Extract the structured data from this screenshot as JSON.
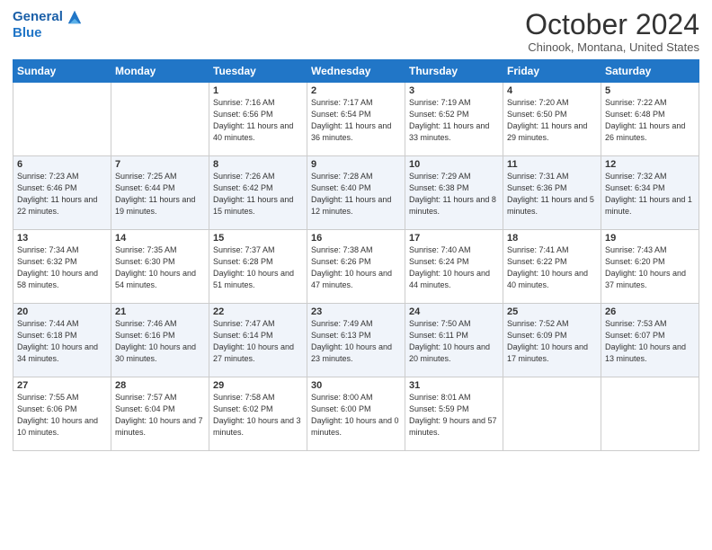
{
  "header": {
    "logo_line1": "General",
    "logo_line2": "Blue",
    "month": "October 2024",
    "location": "Chinook, Montana, United States"
  },
  "days_of_week": [
    "Sunday",
    "Monday",
    "Tuesday",
    "Wednesday",
    "Thursday",
    "Friday",
    "Saturday"
  ],
  "weeks": [
    [
      {
        "day": "",
        "info": ""
      },
      {
        "day": "",
        "info": ""
      },
      {
        "day": "1",
        "info": "Sunrise: 7:16 AM\nSunset: 6:56 PM\nDaylight: 11 hours and 40 minutes."
      },
      {
        "day": "2",
        "info": "Sunrise: 7:17 AM\nSunset: 6:54 PM\nDaylight: 11 hours and 36 minutes."
      },
      {
        "day": "3",
        "info": "Sunrise: 7:19 AM\nSunset: 6:52 PM\nDaylight: 11 hours and 33 minutes."
      },
      {
        "day": "4",
        "info": "Sunrise: 7:20 AM\nSunset: 6:50 PM\nDaylight: 11 hours and 29 minutes."
      },
      {
        "day": "5",
        "info": "Sunrise: 7:22 AM\nSunset: 6:48 PM\nDaylight: 11 hours and 26 minutes."
      }
    ],
    [
      {
        "day": "6",
        "info": "Sunrise: 7:23 AM\nSunset: 6:46 PM\nDaylight: 11 hours and 22 minutes."
      },
      {
        "day": "7",
        "info": "Sunrise: 7:25 AM\nSunset: 6:44 PM\nDaylight: 11 hours and 19 minutes."
      },
      {
        "day": "8",
        "info": "Sunrise: 7:26 AM\nSunset: 6:42 PM\nDaylight: 11 hours and 15 minutes."
      },
      {
        "day": "9",
        "info": "Sunrise: 7:28 AM\nSunset: 6:40 PM\nDaylight: 11 hours and 12 minutes."
      },
      {
        "day": "10",
        "info": "Sunrise: 7:29 AM\nSunset: 6:38 PM\nDaylight: 11 hours and 8 minutes."
      },
      {
        "day": "11",
        "info": "Sunrise: 7:31 AM\nSunset: 6:36 PM\nDaylight: 11 hours and 5 minutes."
      },
      {
        "day": "12",
        "info": "Sunrise: 7:32 AM\nSunset: 6:34 PM\nDaylight: 11 hours and 1 minute."
      }
    ],
    [
      {
        "day": "13",
        "info": "Sunrise: 7:34 AM\nSunset: 6:32 PM\nDaylight: 10 hours and 58 minutes."
      },
      {
        "day": "14",
        "info": "Sunrise: 7:35 AM\nSunset: 6:30 PM\nDaylight: 10 hours and 54 minutes."
      },
      {
        "day": "15",
        "info": "Sunrise: 7:37 AM\nSunset: 6:28 PM\nDaylight: 10 hours and 51 minutes."
      },
      {
        "day": "16",
        "info": "Sunrise: 7:38 AM\nSunset: 6:26 PM\nDaylight: 10 hours and 47 minutes."
      },
      {
        "day": "17",
        "info": "Sunrise: 7:40 AM\nSunset: 6:24 PM\nDaylight: 10 hours and 44 minutes."
      },
      {
        "day": "18",
        "info": "Sunrise: 7:41 AM\nSunset: 6:22 PM\nDaylight: 10 hours and 40 minutes."
      },
      {
        "day": "19",
        "info": "Sunrise: 7:43 AM\nSunset: 6:20 PM\nDaylight: 10 hours and 37 minutes."
      }
    ],
    [
      {
        "day": "20",
        "info": "Sunrise: 7:44 AM\nSunset: 6:18 PM\nDaylight: 10 hours and 34 minutes."
      },
      {
        "day": "21",
        "info": "Sunrise: 7:46 AM\nSunset: 6:16 PM\nDaylight: 10 hours and 30 minutes."
      },
      {
        "day": "22",
        "info": "Sunrise: 7:47 AM\nSunset: 6:14 PM\nDaylight: 10 hours and 27 minutes."
      },
      {
        "day": "23",
        "info": "Sunrise: 7:49 AM\nSunset: 6:13 PM\nDaylight: 10 hours and 23 minutes."
      },
      {
        "day": "24",
        "info": "Sunrise: 7:50 AM\nSunset: 6:11 PM\nDaylight: 10 hours and 20 minutes."
      },
      {
        "day": "25",
        "info": "Sunrise: 7:52 AM\nSunset: 6:09 PM\nDaylight: 10 hours and 17 minutes."
      },
      {
        "day": "26",
        "info": "Sunrise: 7:53 AM\nSunset: 6:07 PM\nDaylight: 10 hours and 13 minutes."
      }
    ],
    [
      {
        "day": "27",
        "info": "Sunrise: 7:55 AM\nSunset: 6:06 PM\nDaylight: 10 hours and 10 minutes."
      },
      {
        "day": "28",
        "info": "Sunrise: 7:57 AM\nSunset: 6:04 PM\nDaylight: 10 hours and 7 minutes."
      },
      {
        "day": "29",
        "info": "Sunrise: 7:58 AM\nSunset: 6:02 PM\nDaylight: 10 hours and 3 minutes."
      },
      {
        "day": "30",
        "info": "Sunrise: 8:00 AM\nSunset: 6:00 PM\nDaylight: 10 hours and 0 minutes."
      },
      {
        "day": "31",
        "info": "Sunrise: 8:01 AM\nSunset: 5:59 PM\nDaylight: 9 hours and 57 minutes."
      },
      {
        "day": "",
        "info": ""
      },
      {
        "day": "",
        "info": ""
      }
    ]
  ]
}
